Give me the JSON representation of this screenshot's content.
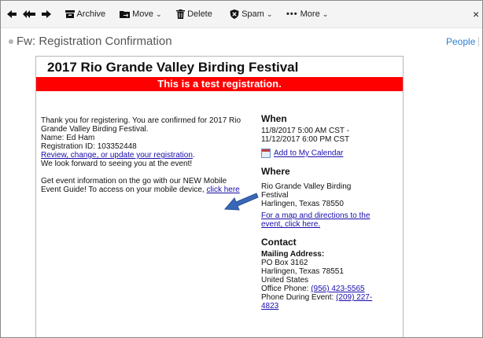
{
  "toolbar": {
    "archive": "Archive",
    "move": "Move",
    "delete": "Delete",
    "spam": "Spam",
    "more": "More",
    "close": "×"
  },
  "subject": {
    "title": "Fw: Registration Confirmation",
    "people": "People"
  },
  "email": {
    "title": "2017 Rio Grande Valley Birding Festival",
    "banner": "This is a test registration.",
    "thanks_1": "Thank you for registering. You are confirmed for 2017 Rio",
    "thanks_2": "Grande Valley Birding Festival.",
    "name": "Name: Ed Ham",
    "reg_id": "Registration ID: 103352448",
    "review_link": "Review, change, or update your registration",
    "review_suffix": ".",
    "forward": "We look forward to seeing you at the event!",
    "guide_1": "Get event information on the go with our NEW Mobile",
    "guide_2": "Event Guide! To access on your mobile device,",
    "guide_link": "click here"
  },
  "when": {
    "heading": "When",
    "line1": "11/8/2017 5:00 AM CST -",
    "line2": "11/12/2017 6:00 PM CST",
    "calendar_link": "Add to My Calendar"
  },
  "where": {
    "heading": "Where",
    "line1": "Rio Grande Valley Birding",
    "line2": "Festival",
    "line3": "Harlingen, Texas 78550",
    "map_link_1": "For a map and directions to the",
    "map_link_2": "event, click here."
  },
  "contact": {
    "heading": "Contact",
    "mailing_label": "Mailing Address:",
    "addr1": "PO Box 3162",
    "addr2": "Harlingen, Texas 78551",
    "addr3": "United States",
    "office_label": "Office Phone:",
    "office_phone": "(956) 423-5565",
    "event_label": "Phone During Event:",
    "event_phone_1": "(209) 227-",
    "event_phone_2": "4823"
  },
  "colors": {
    "banner": "#ff0000",
    "link": "#1a0dab",
    "people_link": "#2a7fd4",
    "arrow": "#3a67b8"
  }
}
